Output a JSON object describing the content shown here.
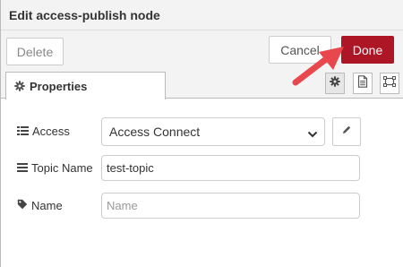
{
  "header": {
    "title": "Edit access-publish node"
  },
  "toolbar": {
    "delete_label": "Delete",
    "cancel_label": "Cancel",
    "done_label": "Done"
  },
  "tabs": [
    {
      "label": "Properties",
      "icon": "gear-icon"
    }
  ],
  "tab_tools": [
    "gear-icon",
    "description-icon",
    "appearance-icon"
  ],
  "form": {
    "access": {
      "label": "Access",
      "icon": "list-icon",
      "selected": "Access Connect"
    },
    "topic": {
      "label": "Topic Name",
      "icon": "bars-icon",
      "value": "test-topic"
    },
    "name": {
      "label": "Name",
      "icon": "tag-icon",
      "value": "",
      "placeholder": "Name"
    }
  },
  "colors": {
    "accent": "#ad1625",
    "annotation_arrow": "#e8474d"
  }
}
